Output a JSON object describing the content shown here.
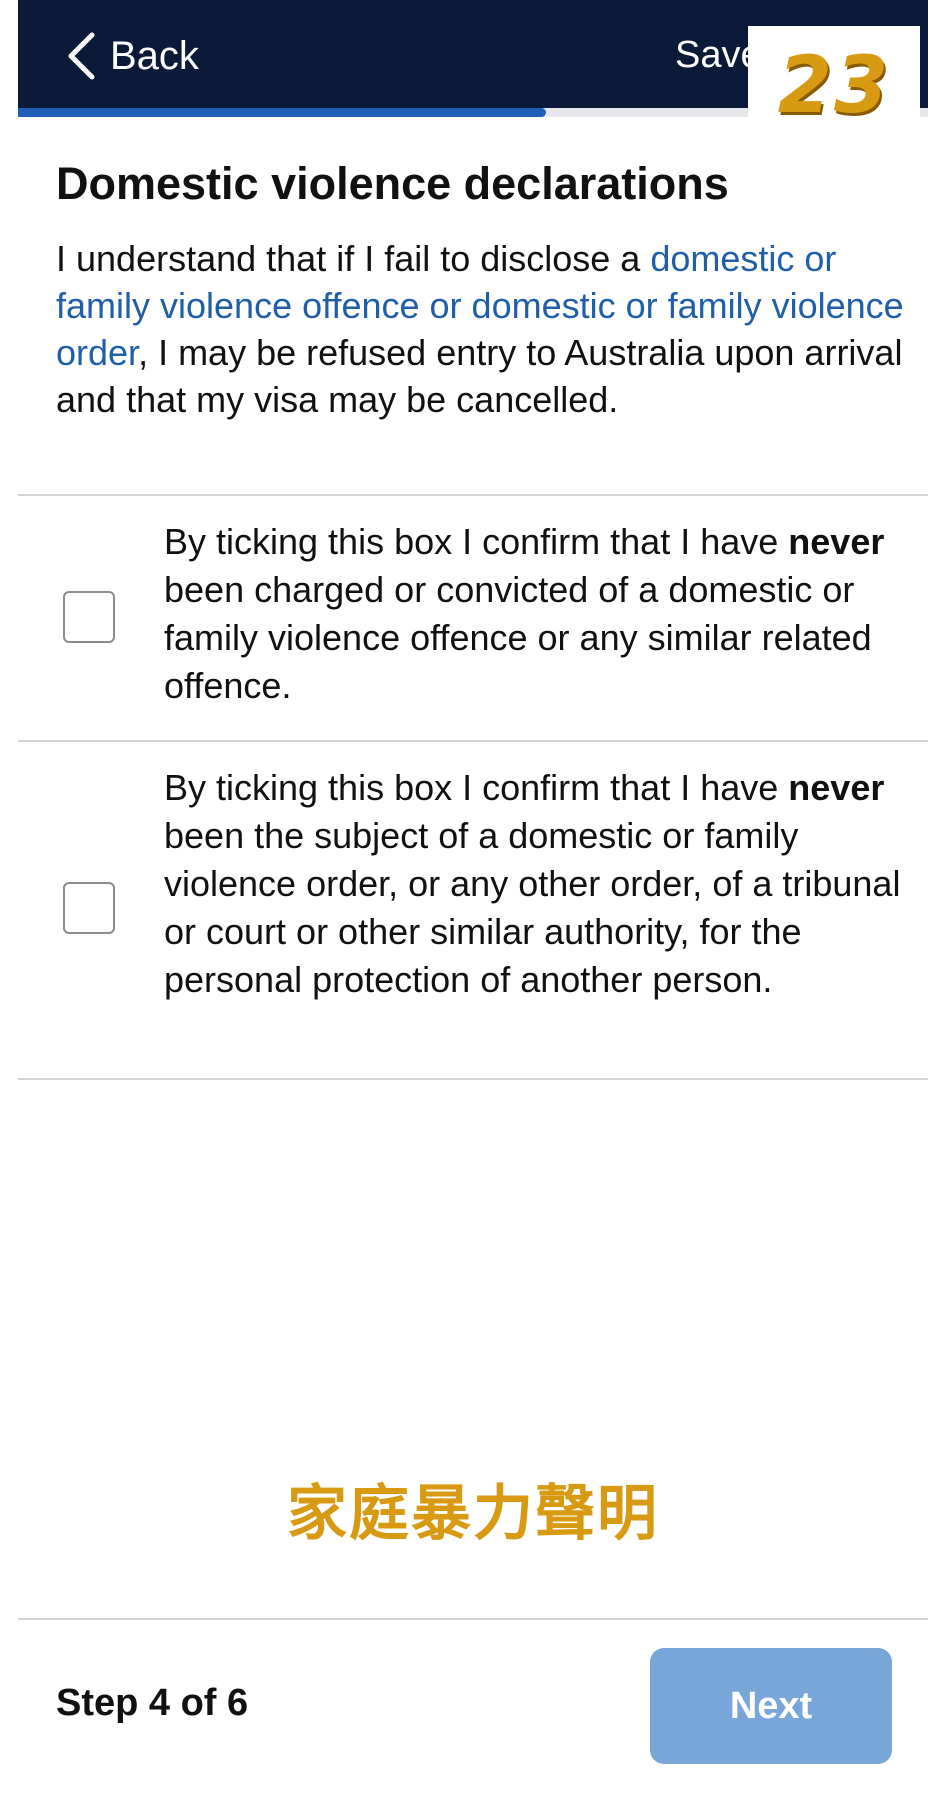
{
  "header": {
    "back_label": "Back",
    "save_label": "Save",
    "background_color": "#0b1a38",
    "progress_fraction": 0.58,
    "progress_color": "#1f5fb6"
  },
  "badge": {
    "text": "23",
    "color": "#d79a12"
  },
  "main": {
    "title": "Domestic violence declarations",
    "intro": {
      "text_before": "I understand that if I fail to disclose a ",
      "link_text": "domestic or family violence offence or domestic or family violence order",
      "text_after": ", I may be refused entry to Australia upon arrival and that my visa may be cancelled.",
      "link_color": "#1f5fa8"
    },
    "declarations": [
      {
        "checked": false,
        "prefix": "By ticking this box I confirm that I have ",
        "emphasis": "never",
        "suffix": " been charged or convicted of a domestic or family violence offence or any similar related offence."
      },
      {
        "checked": false,
        "prefix": "By ticking this box I confirm that I have ",
        "emphasis": "never",
        "suffix": " been the subject of a domestic or family violence order, or any other order, of a tribunal or court or other similar authority, for the personal protection of another person."
      }
    ]
  },
  "caption": {
    "text": "家庭暴力聲明",
    "color": "#d79a12"
  },
  "footer": {
    "step_label": "Step 4 of 6",
    "next_label": "Next",
    "next_color": "#79a6d8"
  }
}
